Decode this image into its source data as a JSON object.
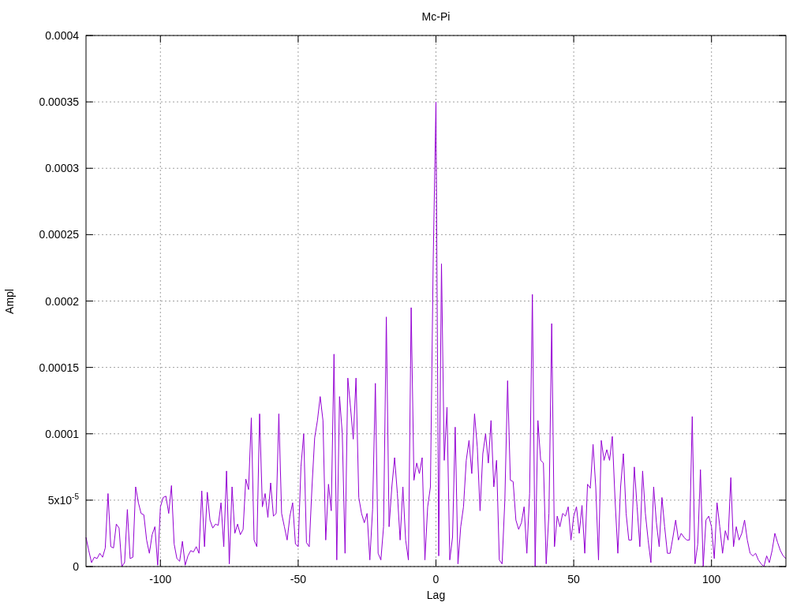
{
  "chart_data": {
    "type": "line",
    "title": "Mc-Pi",
    "xlabel": "Lag",
    "ylabel": "Ampl",
    "grid": true,
    "xlim": [
      -127,
      127
    ],
    "ylim": [
      0,
      0.0004
    ],
    "xticks": [
      -100,
      -50,
      0,
      50,
      100
    ],
    "yticks": [
      0,
      {
        "value": 5e-05,
        "label": "5x10$^{-5}$"
      },
      0.0001,
      0.00015,
      0.0002,
      0.00025,
      0.0003,
      0.00035,
      0.0004
    ],
    "x": [
      -127,
      -126,
      -125,
      -124,
      -123,
      -122,
      -121,
      -120,
      -119,
      -118,
      -117,
      -116,
      -115,
      -114,
      -113,
      -112,
      -111,
      -110,
      -109,
      -108,
      -107,
      -106,
      -105,
      -104,
      -103,
      -102,
      -101,
      -100,
      -99,
      -98,
      -97,
      -96,
      -95,
      -94,
      -93,
      -92,
      -91,
      -90,
      -89,
      -88,
      -87,
      -86,
      -85,
      -84,
      -83,
      -82,
      -81,
      -80,
      -79,
      -78,
      -77,
      -76,
      -75,
      -74,
      -73,
      -72,
      -71,
      -70,
      -69,
      -68,
      -67,
      -66,
      -65,
      -64,
      -63,
      -62,
      -61,
      -60,
      -59,
      -58,
      -57,
      -56,
      -55,
      -54,
      -53,
      -52,
      -51,
      -50,
      -49,
      -48,
      -47,
      -46,
      -45,
      -44,
      -43,
      -42,
      -41,
      -40,
      -39,
      -38,
      -37,
      -36,
      -35,
      -34,
      -33,
      -32,
      -31,
      -30,
      -29,
      -28,
      -27,
      -26,
      -25,
      -24,
      -23,
      -22,
      -21,
      -20,
      -19,
      -18,
      -17,
      -16,
      -15,
      -14,
      -13,
      -12,
      -11,
      -10,
      -9,
      -8,
      -7,
      -6,
      -5,
      -4,
      -3,
      -2,
      -1,
      0,
      1,
      2,
      3,
      4,
      5,
      6,
      7,
      8,
      9,
      10,
      11,
      12,
      13,
      14,
      15,
      16,
      17,
      18,
      19,
      20,
      21,
      22,
      23,
      24,
      25,
      26,
      27,
      28,
      29,
      30,
      31,
      32,
      33,
      34,
      35,
      36,
      37,
      38,
      39,
      40,
      41,
      42,
      43,
      44,
      45,
      46,
      47,
      48,
      49,
      50,
      51,
      52,
      53,
      54,
      55,
      56,
      57,
      58,
      59,
      60,
      61,
      62,
      63,
      64,
      65,
      66,
      67,
      68,
      69,
      70,
      71,
      72,
      73,
      74,
      75,
      76,
      77,
      78,
      79,
      80,
      81,
      82,
      83,
      84,
      85,
      86,
      87,
      88,
      89,
      90,
      91,
      92,
      93,
      94,
      95,
      96,
      97,
      98,
      99,
      100,
      101,
      102,
      103,
      104,
      105,
      106,
      107,
      108,
      109,
      110,
      111,
      112,
      113,
      114,
      115,
      116,
      117,
      118,
      119,
      120,
      121,
      122,
      123,
      124,
      125,
      126,
      127
    ],
    "series": [
      {
        "color": "#9400d3",
        "values": [
          2.2e-05,
          1.2e-05,
          3e-06,
          7e-06,
          6e-06,
          1e-05,
          7e-06,
          1.4e-05,
          5.5e-05,
          1.5e-05,
          1.4e-05,
          3.2e-05,
          2.9e-05,
          0,
          3e-06,
          4.3e-05,
          6e-06,
          7e-06,
          6e-05,
          4.8e-05,
          4e-05,
          3.9e-05,
          2e-05,
          1e-05,
          2.4e-05,
          3e-05,
          1e-06,
          4.5e-05,
          5.2e-05,
          5.3e-05,
          4e-05,
          6.1e-05,
          1.7e-05,
          6e-06,
          4e-06,
          1.9e-05,
          1e-06,
          8e-06,
          1.2e-05,
          1.1e-05,
          1.5e-05,
          1e-05,
          5.7e-05,
          1.5e-05,
          5.6e-05,
          3.5e-05,
          2.9e-05,
          3.2e-05,
          3.1e-05,
          4.8e-05,
          1.5e-05,
          7.2e-05,
          2e-06,
          6e-05,
          2.5e-05,
          3.2e-05,
          2.4e-05,
          2.8e-05,
          6.6e-05,
          5.8e-05,
          0.000112,
          2e-05,
          1.5e-05,
          0.000115,
          4.5e-05,
          5.5e-05,
          3.7e-05,
          6.3e-05,
          3.8e-05,
          4e-05,
          0.000115,
          4e-05,
          3e-05,
          2e-05,
          3.8e-05,
          4.8e-05,
          1.7e-05,
          1.5e-05,
          7.5e-05,
          0.0001,
          1.8e-05,
          1.5e-05,
          6e-05,
          9.7e-05,
          0.00011,
          0.000128,
          0.00011,
          2e-05,
          6.2e-05,
          4.2e-05,
          0.00016,
          5e-06,
          0.000128,
          0.0001,
          1e-05,
          0.000142,
          0.00012,
          9.6e-05,
          0.000142,
          5.2e-05,
          4e-05,
          3.3e-05,
          4e-05,
          5e-06,
          4.3e-05,
          0.000138,
          1e-05,
          5e-06,
          3e-05,
          0.000188,
          3e-05,
          6e-05,
          8.2e-05,
          5.5e-05,
          2e-05,
          6e-05,
          2e-05,
          5e-06,
          0.000195,
          6.5e-05,
          7.8e-05,
          7e-05,
          8.2e-05,
          5e-06,
          4.5e-05,
          6e-05,
          0.00023,
          0.00035,
          8e-06,
          0.000228,
          8e-05,
          0.00012,
          5e-06,
          2.2e-05,
          0.000105,
          2e-06,
          3e-05,
          4.5e-05,
          8e-05,
          9.5e-05,
          7e-05,
          0.000115,
          9e-05,
          4.2e-05,
          8.5e-05,
          0.0001,
          7.8e-05,
          0.00011,
          6e-05,
          8e-05,
          5e-06,
          2e-06,
          5e-05,
          0.00014,
          6.5e-05,
          6.4e-05,
          3.5e-05,
          2.8e-05,
          3.3e-05,
          4.5e-05,
          1e-05,
          5.5e-05,
          0.000205,
          0,
          0.00011,
          8e-05,
          7.8e-05,
          2e-06,
          4e-05,
          0.000183,
          1.5e-05,
          3.8e-05,
          3e-05,
          4e-05,
          3.8e-05,
          4.5e-05,
          2e-05,
          3.8e-05,
          4.5e-05,
          2.5e-05,
          4.6e-05,
          1e-05,
          6.2e-05,
          5.9e-05,
          9.2e-05,
          6e-05,
          5e-06,
          9.5e-05,
          8e-05,
          8.8e-05,
          8e-05,
          9.8e-05,
          5e-05,
          1e-05,
          6e-05,
          8.5e-05,
          4e-05,
          2e-05,
          2e-05,
          7.5e-05,
          4.5e-05,
          1.5e-05,
          7.2e-05,
          4e-05,
          2e-05,
          3e-06,
          6e-05,
          3.3e-05,
          1.5e-05,
          5.2e-05,
          3e-05,
          1e-05,
          1e-05,
          2.2e-05,
          3.5e-05,
          2e-05,
          2.5e-05,
          2.2e-05,
          2e-05,
          2e-05,
          0.000113,
          2e-06,
          1.7e-05,
          7.3e-05,
          0,
          3.5e-05,
          3.8e-05,
          3e-05,
          6e-06,
          4.8e-05,
          3e-05,
          1e-05,
          2.7e-05,
          2e-05,
          6.7e-05,
          1.5e-05,
          3e-05,
          2e-05,
          2.5e-05,
          3.5e-05,
          2e-05,
          1e-05,
          8e-06,
          1e-05,
          5e-06,
          2e-06,
          0,
          8e-06,
          3e-06,
          1.2e-05,
          2.5e-05,
          1.8e-05,
          1.2e-05,
          8e-06,
          6e-06
        ]
      }
    ]
  }
}
